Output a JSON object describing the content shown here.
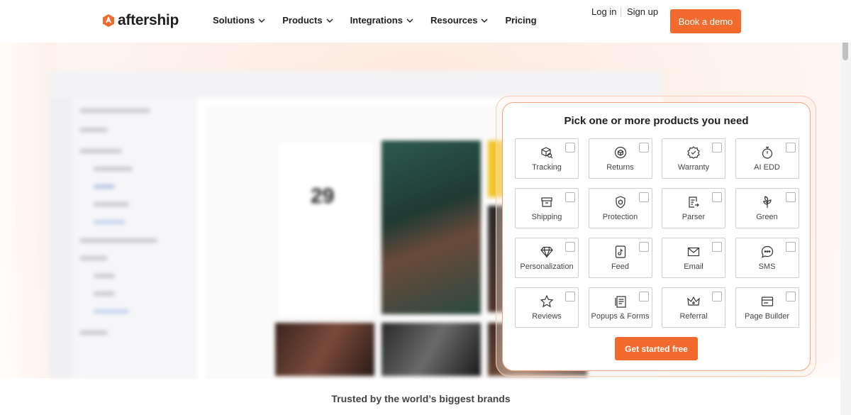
{
  "brand": {
    "name": "aftership",
    "accent": "#f26a2e"
  },
  "nav": {
    "items": [
      {
        "label": "Solutions",
        "has_dropdown": true
      },
      {
        "label": "Products",
        "has_dropdown": true
      },
      {
        "label": "Integrations",
        "has_dropdown": true
      },
      {
        "label": "Resources",
        "has_dropdown": true
      },
      {
        "label": "Pricing",
        "has_dropdown": false
      }
    ],
    "login": "Log in",
    "signup": "Sign up",
    "demo": "Book a demo"
  },
  "mockup": {
    "big_number": "29"
  },
  "picker": {
    "title": "Pick one or more products you need",
    "products": [
      {
        "label": "Tracking",
        "icon": "package-search-icon",
        "checked": false
      },
      {
        "label": "Returns",
        "icon": "return-box-icon",
        "checked": false
      },
      {
        "label": "Warranty",
        "icon": "warranty-badge-icon",
        "checked": false
      },
      {
        "label": "AI EDD",
        "icon": "stopwatch-icon",
        "checked": false
      },
      {
        "label": "Shipping",
        "icon": "shipping-box-icon",
        "checked": false
      },
      {
        "label": "Protection",
        "icon": "shield-icon",
        "checked": false
      },
      {
        "label": "Parser",
        "icon": "document-parse-icon",
        "checked": false
      },
      {
        "label": "Green",
        "icon": "leaf-icon",
        "checked": false
      },
      {
        "label": "Personalization",
        "icon": "diamond-icon",
        "checked": false
      },
      {
        "label": "Feed",
        "icon": "tiktok-icon",
        "checked": false
      },
      {
        "label": "Email",
        "icon": "email-icon",
        "checked": false
      },
      {
        "label": "SMS",
        "icon": "chat-bubble-icon",
        "checked": false
      },
      {
        "label": "Reviews",
        "icon": "star-icon",
        "checked": false
      },
      {
        "label": "Popups & Forms",
        "icon": "form-icon",
        "checked": false
      },
      {
        "label": "Referral",
        "icon": "crown-icon",
        "checked": false
      },
      {
        "label": "Page Builder",
        "icon": "page-builder-icon",
        "checked": false
      }
    ],
    "cta": "Get started free"
  },
  "trusted": "Trusted by the world’s biggest brands"
}
